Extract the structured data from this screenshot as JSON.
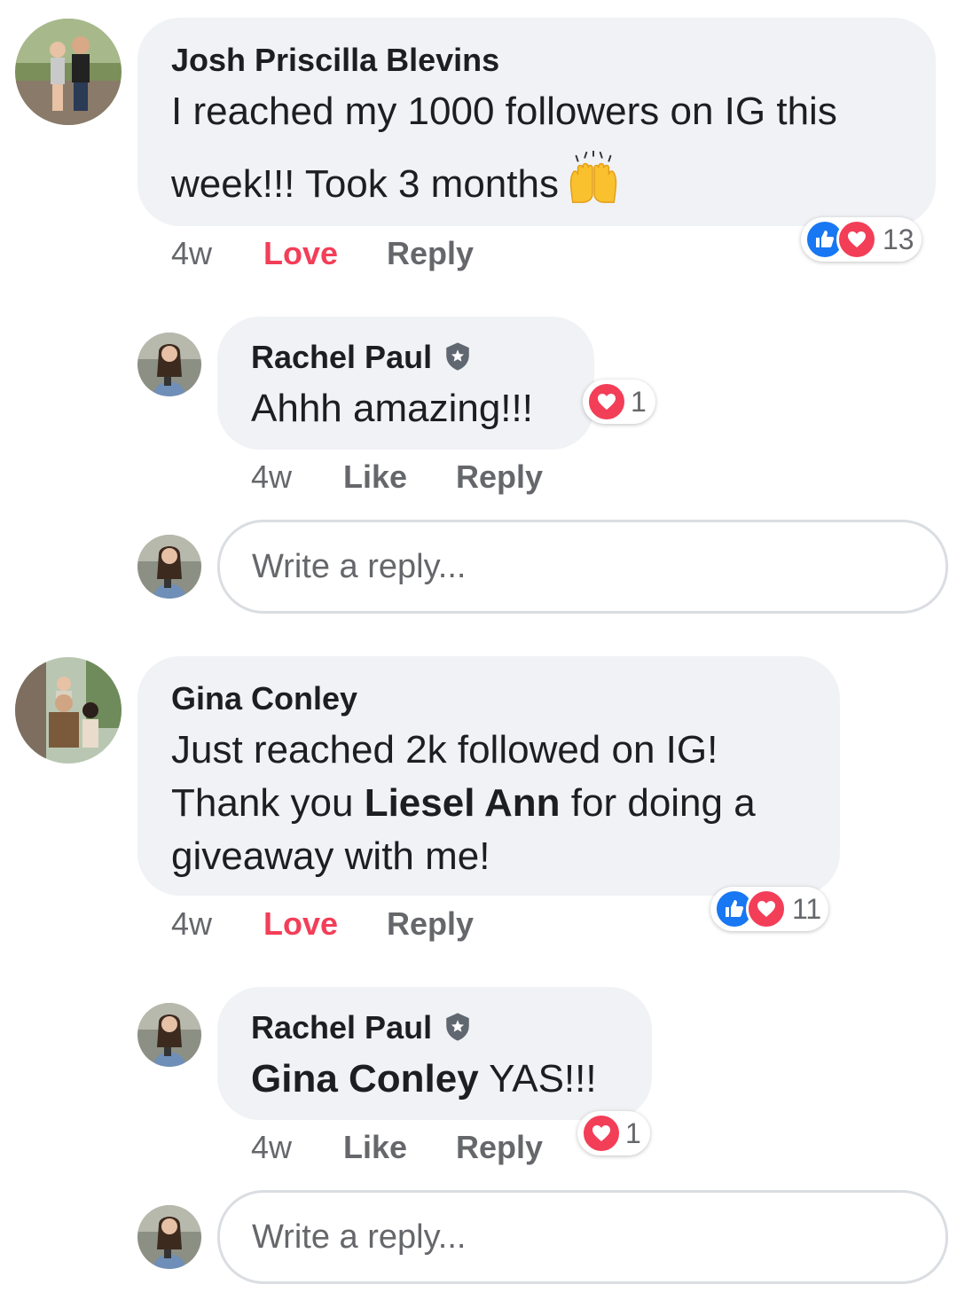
{
  "comments": [
    {
      "author": "Josh Priscilla Blevins",
      "line1": "I reached my 1000 followers on IG this",
      "line2": "week!!! Took 3 months",
      "emoji": "raising-hands",
      "time": "4w",
      "love_label": "Love",
      "reply_label": "Reply",
      "reaction_count": "13",
      "reply": {
        "author": "Rachel Paul",
        "text": "Ahhh amazing!!!",
        "time": "4w",
        "like_label": "Like",
        "reply_label": "Reply",
        "reaction_count": "1"
      },
      "reply_placeholder": "Write a reply..."
    },
    {
      "author": "Gina Conley",
      "line1": "Just reached 2k followed on IG!",
      "line2_prefix": "Thank you ",
      "line2_mention": "Liesel Ann",
      "line2_suffix": " for doing a",
      "line3": "giveaway with me!",
      "time": "4w",
      "love_label": "Love",
      "reply_label": "Reply",
      "reaction_count": "11",
      "reply": {
        "author": "Rachel Paul",
        "mention": "Gina Conley",
        "text": " YAS!!!",
        "time": "4w",
        "like_label": "Like",
        "reply_label": "Reply",
        "reaction_count": "1"
      },
      "reply_placeholder": "Write a reply..."
    }
  ],
  "colors": {
    "bubble": "#f0f2f5",
    "love_red": "#f33e58",
    "like_blue": "#1877f2",
    "meta_gray": "#65676b"
  }
}
